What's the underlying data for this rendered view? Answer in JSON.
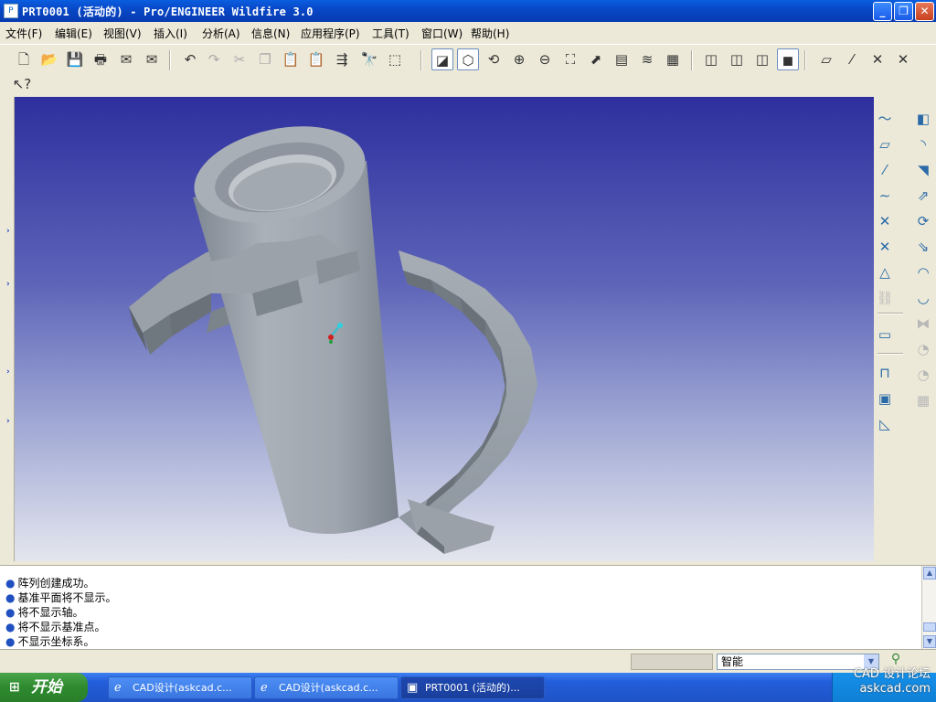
{
  "window": {
    "title": "PRT0001 (活动的) - Pro/ENGINEER Wildfire 3.0",
    "buttons": [
      "minimize",
      "restore",
      "close"
    ]
  },
  "menu": [
    {
      "label": "文件(F)"
    },
    {
      "label": "编辑(E)"
    },
    {
      "label": "视图(V)"
    },
    {
      "label": "插入(I)"
    },
    {
      "label": "分析(A)"
    },
    {
      "label": "信息(N)"
    },
    {
      "label": "应用程序(P)"
    },
    {
      "label": "工具(T)"
    },
    {
      "label": "窗口(W)"
    },
    {
      "label": "帮助(H)"
    }
  ],
  "toolbar": [
    {
      "icon": "new-file-icon",
      "glyph": "🗋"
    },
    {
      "icon": "open-folder-icon",
      "glyph": "📂"
    },
    {
      "icon": "save-icon",
      "glyph": "💾"
    },
    {
      "icon": "print-icon",
      "glyph": "🖶"
    },
    {
      "icon": "send-mail-icon",
      "glyph": "✉"
    },
    {
      "icon": "email-attach-icon",
      "glyph": "✉"
    },
    {
      "icon": "undo-icon",
      "glyph": "↶"
    },
    {
      "icon": "redo-icon",
      "glyph": "↷",
      "disabled": true
    },
    {
      "icon": "cut-icon",
      "glyph": "✂",
      "disabled": true
    },
    {
      "icon": "copy-icon",
      "glyph": "❐",
      "disabled": true
    },
    {
      "icon": "paste-icon",
      "glyph": "📋",
      "disabled": true
    },
    {
      "icon": "paste-special-icon",
      "glyph": "📋",
      "disabled": true
    },
    {
      "icon": "regenerate-icon",
      "glyph": "⇶"
    },
    {
      "icon": "find-icon",
      "glyph": "🔭"
    },
    {
      "icon": "selection-box-icon",
      "glyph": "⬚"
    },
    {
      "icon": "repaint-icon",
      "glyph": "◪",
      "active": true
    },
    {
      "icon": "spin-center-icon",
      "glyph": "⬡",
      "active": true
    },
    {
      "icon": "orient-mode-icon",
      "glyph": "⟲"
    },
    {
      "icon": "zoom-in-icon",
      "glyph": "⊕"
    },
    {
      "icon": "zoom-out-icon",
      "glyph": "⊖"
    },
    {
      "icon": "refit-icon",
      "glyph": "⛶"
    },
    {
      "icon": "reorient-icon",
      "glyph": "⬈"
    },
    {
      "icon": "saved-views-icon",
      "glyph": "▤"
    },
    {
      "icon": "layers-icon",
      "glyph": "≋"
    },
    {
      "icon": "view-manager-icon",
      "glyph": "▦"
    },
    {
      "icon": "wireframe-icon",
      "glyph": "◫"
    },
    {
      "icon": "hidden-line-icon",
      "glyph": "◫"
    },
    {
      "icon": "no-hidden-icon",
      "glyph": "◫"
    },
    {
      "icon": "shading-icon",
      "glyph": "◼",
      "active": true
    },
    {
      "icon": "datum-planes-icon",
      "glyph": "▱"
    },
    {
      "icon": "datum-axes-icon",
      "glyph": "⁄"
    },
    {
      "icon": "datum-points-icon",
      "glyph": "✕"
    },
    {
      "icon": "coordinate-systems-icon",
      "glyph": "✕"
    }
  ],
  "context_help_icon": "context-help-icon",
  "right_toolbar": [
    {
      "icon": "sketched-curve-icon",
      "glyph": "〜"
    },
    {
      "icon": "datum-plane-tool-icon",
      "glyph": "▱"
    },
    {
      "icon": "datum-axis-tool-icon",
      "glyph": "⁄"
    },
    {
      "icon": "datum-curve-tool-icon",
      "glyph": "∼"
    },
    {
      "icon": "datum-point-tool-icon",
      "glyph": "✕"
    },
    {
      "icon": "coordinate-system-tool-icon",
      "glyph": "✕"
    },
    {
      "icon": "analysis-feature-icon",
      "glyph": "△"
    },
    {
      "icon": "datum-chain-icon",
      "glyph": "⛓",
      "disabled": true
    },
    {
      "icon": "sketch-tool-icon",
      "glyph": "▭"
    },
    {
      "icon": "hole-tool-icon",
      "glyph": "⊓"
    },
    {
      "icon": "shell-tool-icon",
      "glyph": "▣"
    },
    {
      "icon": "rib-tool-icon",
      "glyph": "◺"
    },
    {
      "icon": "draft-tool-icon",
      "glyph": "◧"
    },
    {
      "icon": "round-tool-icon",
      "glyph": "◝"
    },
    {
      "icon": "chamfer-tool-icon",
      "glyph": "◥"
    },
    {
      "icon": "extrude-tool-icon",
      "glyph": "⇗"
    },
    {
      "icon": "revolve-tool-icon",
      "glyph": "⟳"
    },
    {
      "icon": "variable-sweep-icon",
      "glyph": "⇘"
    },
    {
      "icon": "boundary-blend-icon",
      "glyph": "◠"
    },
    {
      "icon": "style-tool-icon",
      "glyph": "◡"
    },
    {
      "icon": "mirror-tool-icon",
      "glyph": "⧓",
      "disabled": true
    },
    {
      "icon": "merge-tool-icon",
      "glyph": "◔",
      "disabled": true
    },
    {
      "icon": "trim-tool-icon",
      "glyph": "◔",
      "disabled": true
    },
    {
      "icon": "pattern-tool-icon",
      "glyph": "▦",
      "disabled": true
    }
  ],
  "messages": [
    "阵列创建成功。",
    "基准平面将不显示。",
    "将不显示轴。",
    "将不显示基准点。",
    "不显示坐标系。"
  ],
  "status": {
    "filter_value": "智能"
  },
  "taskbar": {
    "start_label": "开始",
    "tasks": [
      {
        "label": "CAD设计(askcad.c...",
        "icon": "ie-icon"
      },
      {
        "label": "CAD设计(askcad.c...",
        "icon": "ie-icon"
      },
      {
        "label": "PRT0001 (活动的)...",
        "icon": "proe-window-icon",
        "active": true
      }
    ]
  },
  "watermark": {
    "line1": "CAD 设计论坛",
    "line2": "askcad.com"
  },
  "colors": {
    "viewport_top": "#2e2f9e",
    "viewport_bottom": "#e4e6ee",
    "model": "#9aa2ab",
    "titlebar": "#0a5ee0",
    "taskbar": "#245edb"
  }
}
